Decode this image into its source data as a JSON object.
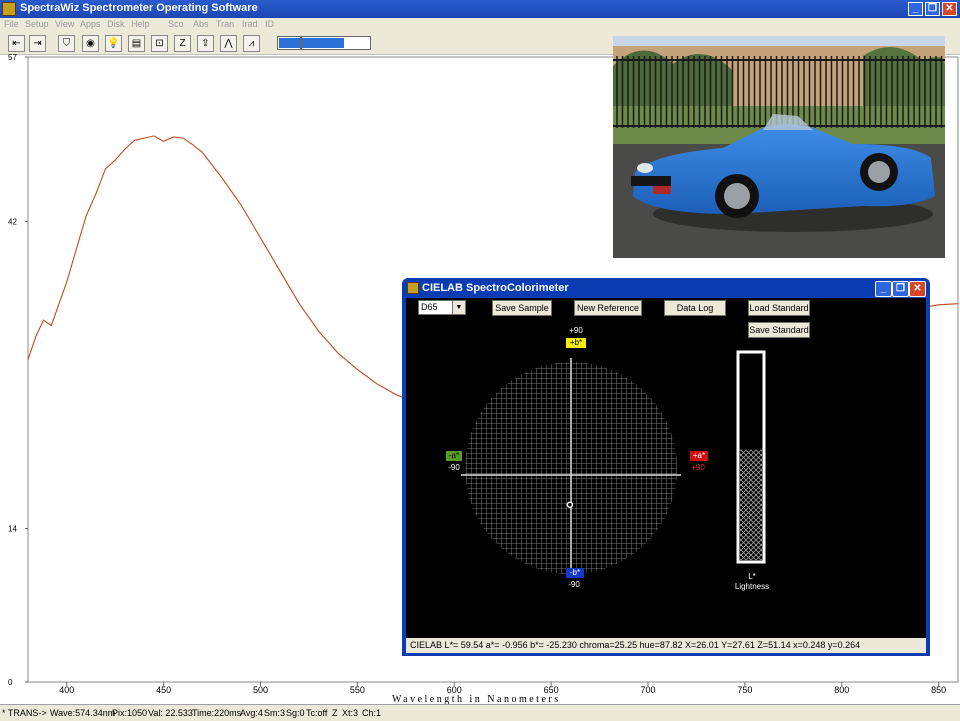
{
  "window": {
    "title": "SpectraWiz  Spectrometer Operating Software",
    "controls": [
      "_",
      "❐",
      "✕"
    ]
  },
  "menu": [
    "File",
    "Setup",
    "View",
    "Apps",
    "Disk",
    "Help",
    "Sco",
    "Abs",
    "Tran",
    "Irad",
    "ID"
  ],
  "toolbar": {
    "tools": [
      "⇤",
      "⇥",
      "⛉",
      "◉",
      "💡",
      "▤",
      "⊡",
      "Z",
      "⇪",
      "⋀",
      "⩘"
    ],
    "progress": 0.72
  },
  "plot": {
    "y_ticks": [
      "57",
      "42",
      "14",
      "0"
    ],
    "x_ticks": [
      "400",
      "450",
      "500",
      "550",
      "600",
      "650",
      "700",
      "750",
      "800",
      "850"
    ],
    "xlabel": "Wavelength in Nanometers"
  },
  "chart_data": {
    "type": "line",
    "xlabel": "Wavelength in Nanometers",
    "ylabel": "",
    "xlim": [
      380,
      860
    ],
    "ylim": [
      0,
      57
    ],
    "x": [
      380,
      384,
      388,
      392,
      396,
      400,
      405,
      410,
      415,
      420,
      425,
      430,
      435,
      440,
      445,
      450,
      455,
      460,
      465,
      470,
      480,
      490,
      500,
      510,
      520,
      530,
      540,
      550,
      560,
      570,
      580,
      590,
      600,
      604,
      840,
      850,
      860
    ],
    "series": [
      {
        "color": "#c04a1c",
        "y": [
          29.4,
          31.5,
          33.0,
          32.5,
          34.5,
          36.5,
          39.5,
          42.5,
          44.5,
          46.8,
          47.6,
          48.6,
          49.4,
          49.6,
          49.8,
          49.3,
          49.7,
          49.6,
          49.0,
          48.3,
          46.0,
          43.5,
          40.5,
          37.5,
          34.5,
          32.0,
          30.0,
          28.5,
          27.2,
          26.2,
          25.5,
          25.0,
          24.7,
          24.6,
          34.1,
          34.4,
          34.5
        ]
      }
    ]
  },
  "dialog": {
    "title": "CIELAB SpectroColorimeter",
    "controls": [
      "_",
      "❐",
      "✕"
    ],
    "illuminant": "D65",
    "buttons": {
      "save_sample": "Save Sample",
      "new_reference": "New Reference",
      "data_log": "Data Log",
      "load_standard": "Load Standard",
      "save_standard": "Save Standard"
    },
    "axes": {
      "top_value": "+90",
      "top_tag": "+b*",
      "left_tag": "-a*",
      "left_value": "-90",
      "right_tag": "+a*",
      "right_value": "+90",
      "bottom_tag": "-b*",
      "bottom_value": "-90"
    },
    "lightness_label": "L*",
    "lightness_caption": "Lightness",
    "lightness_value": 0.5954,
    "sample_a": -0.956,
    "sample_b": -25.23,
    "status": "CIELAB L*= 59.54   a*= -0.956   b*= -25.230   chroma=25.25   hue=87.82  X=26.01   Y=27.61   Z=51.14   x=0.248  y=0.264",
    "colors": {
      "plus_b": "#f4f000",
      "minus_a": "#5a9a28",
      "plus_a": "#d01010",
      "minus_b": "#1438c8"
    }
  },
  "status_bar": {
    "mode": "* TRANS->",
    "wave": "Wave:574.34nm",
    "pix": "Pix:1050",
    "val": "Val: 22.533",
    "time": "Time:220ms",
    "avg": "Avg:4",
    "sm": "Sm:3",
    "sg": "Sg:0",
    "tc": "Tc:off",
    "z": "Z",
    "xt": "Xt:3",
    "ch": "Ch:1"
  }
}
